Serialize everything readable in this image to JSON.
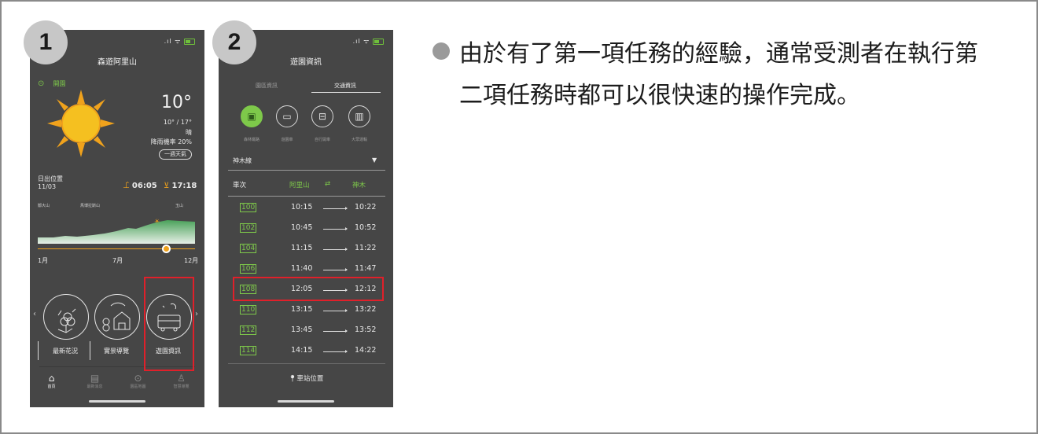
{
  "badges": [
    "1",
    "2"
  ],
  "phone1": {
    "title": "森遊阿里山",
    "status_label": "開園",
    "temperature": "10°",
    "temp_range": "10° / 17°",
    "weather": "晴",
    "rain_chance": "降雨機率 20%",
    "week_weather_button": "一週天氣",
    "sunrise_label": "日出位置",
    "date": "11/03",
    "sunrise_time": "06:05",
    "sunset_time": "17:18",
    "peaks": [
      "鄒大山",
      "馬博拉斯山",
      "玉山"
    ],
    "months": [
      "1月",
      "7月",
      "12月"
    ],
    "categories": [
      "最新花況",
      "實景導覽",
      "遊園資訊"
    ],
    "tabs": [
      "首頁",
      "最新消息",
      "園區地圖",
      "智慧導覽"
    ]
  },
  "phone2": {
    "title": "遊園資訊",
    "tabs": [
      "園區資訊",
      "交通資訊"
    ],
    "transport_modes": [
      "森林鐵路",
      "遊園車",
      "自行開車",
      "大眾運輸"
    ],
    "line_select": "神木線",
    "table_headers": {
      "train": "車次",
      "from": "阿里山",
      "swap": "⇄",
      "to": "神木"
    },
    "trains": [
      {
        "no": "100",
        "dep": "10:15",
        "arr": "10:22"
      },
      {
        "no": "102",
        "dep": "10:45",
        "arr": "10:52"
      },
      {
        "no": "104",
        "dep": "11:15",
        "arr": "11:22"
      },
      {
        "no": "106",
        "dep": "11:40",
        "arr": "11:47"
      },
      {
        "no": "108",
        "dep": "12:05",
        "arr": "12:12"
      },
      {
        "no": "110",
        "dep": "13:15",
        "arr": "13:22"
      },
      {
        "no": "112",
        "dep": "13:45",
        "arr": "13:52"
      },
      {
        "no": "114",
        "dep": "14:15",
        "arr": "14:22"
      }
    ],
    "station_button": "車站位置"
  },
  "description": "由於有了第一項任務的經驗，通常受測者在執行第二項任務時都可以很快速的操作完成。",
  "colors": {
    "accent_green": "#7ec94a",
    "highlight_red": "#e0202a",
    "phone_bg": "#464646"
  }
}
